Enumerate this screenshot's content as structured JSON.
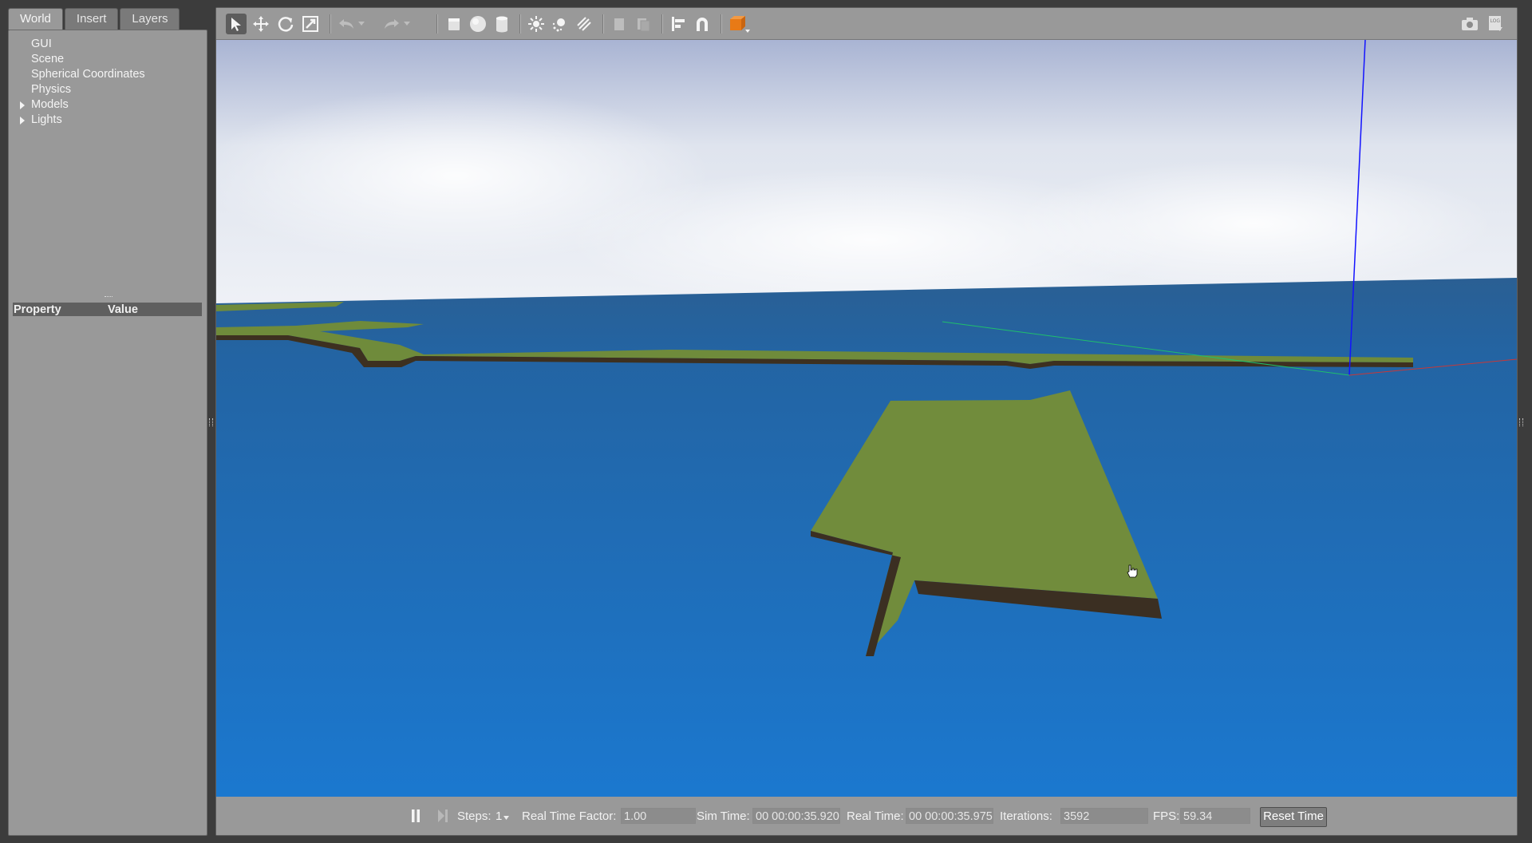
{
  "left_panel": {
    "tabs": [
      {
        "label": "World",
        "active": true
      },
      {
        "label": "Insert",
        "active": false
      },
      {
        "label": "Layers",
        "active": false
      }
    ],
    "tree": [
      {
        "label": "GUI",
        "expandable": false
      },
      {
        "label": "Scene",
        "expandable": false
      },
      {
        "label": "Spherical Coordinates",
        "expandable": false
      },
      {
        "label": "Physics",
        "expandable": false
      },
      {
        "label": "Models",
        "expandable": true
      },
      {
        "label": "Lights",
        "expandable": true
      }
    ],
    "property_header": {
      "property": "Property",
      "value": "Value"
    }
  },
  "toolbar": {
    "icons": [
      "select-arrow-icon",
      "translate-icon",
      "rotate-icon",
      "scale-icon",
      "undo-icon",
      "undo-dropdown-icon",
      "redo-icon",
      "redo-dropdown-icon",
      "box-shape-icon",
      "sphere-shape-icon",
      "cylinder-shape-icon",
      "point-light-icon",
      "spot-light-icon",
      "directional-light-icon",
      "copy-icon",
      "paste-icon",
      "align-icon",
      "snap-magnet-icon",
      "change-view-icon",
      "screenshot-icon",
      "log-icon"
    ]
  },
  "statusbar": {
    "steps_label": "Steps:",
    "steps_value": "1",
    "rtf_label": "Real Time Factor:",
    "rtf_value": "1.00",
    "sim_time_label": "Sim Time:",
    "sim_time_value": "00 00:00:35.920",
    "real_time_label": "Real Time:",
    "real_time_value": "00 00:00:35.975",
    "iterations_label": "Iterations:",
    "iterations_value": "3592",
    "fps_label": "FPS:",
    "fps_value": "59.34",
    "reset_label": "Reset Time"
  },
  "colors": {
    "panel": "#999999",
    "background": "#3c3c3c",
    "sky": "#e9edf3",
    "water": "#1f6db5",
    "grass": "#6f8b3b",
    "accent_orange": "#e87a16"
  }
}
